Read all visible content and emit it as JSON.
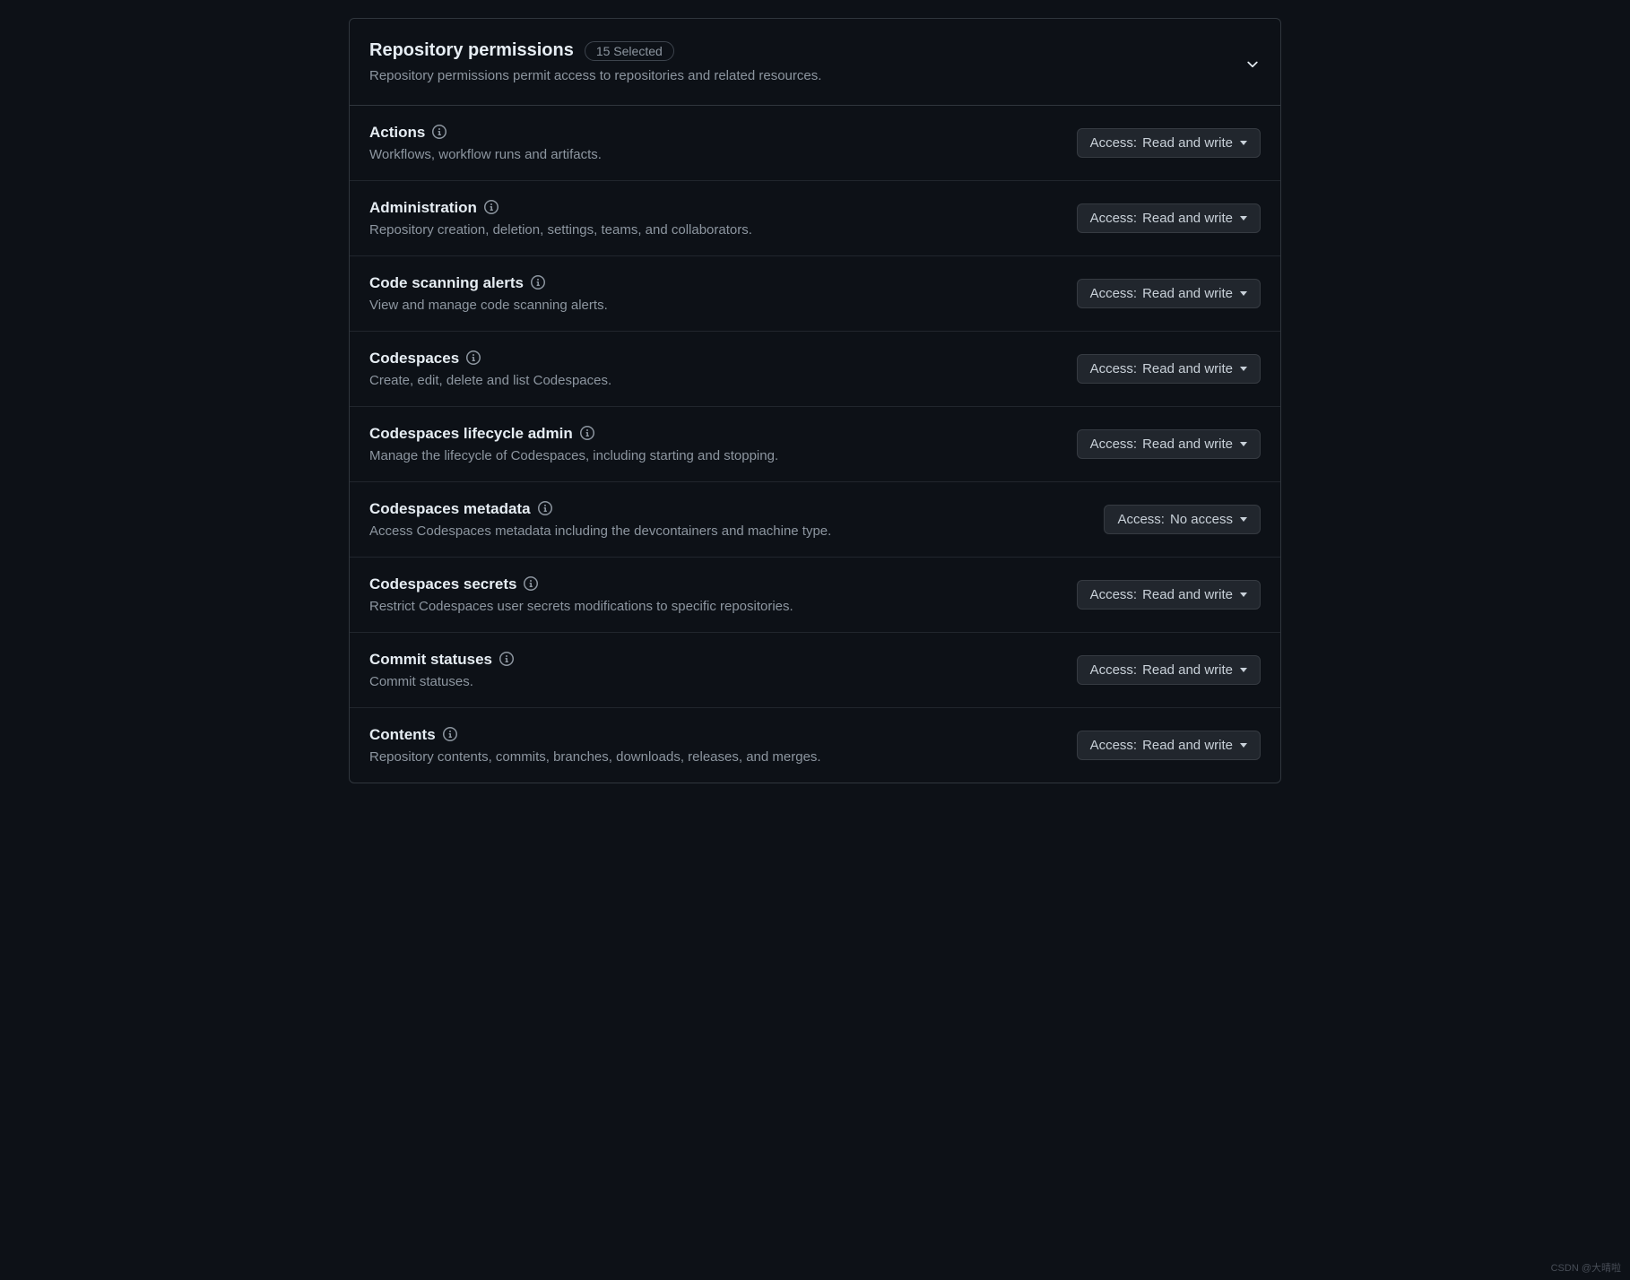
{
  "header": {
    "title": "Repository permissions",
    "selected_badge": "15 Selected",
    "subtitle": "Repository permissions permit access to repositories and related resources."
  },
  "access_prefix": "Access: ",
  "permissions": [
    {
      "title": "Actions",
      "desc": "Workflows, workflow runs and artifacts.",
      "access": "Read and write"
    },
    {
      "title": "Administration",
      "desc": "Repository creation, deletion, settings, teams, and collaborators.",
      "access": "Read and write"
    },
    {
      "title": "Code scanning alerts",
      "desc": "View and manage code scanning alerts.",
      "access": "Read and write"
    },
    {
      "title": "Codespaces",
      "desc": "Create, edit, delete and list Codespaces.",
      "access": "Read and write"
    },
    {
      "title": "Codespaces lifecycle admin",
      "desc": "Manage the lifecycle of Codespaces, including starting and stopping.",
      "access": "Read and write"
    },
    {
      "title": "Codespaces metadata",
      "desc": "Access Codespaces metadata including the devcontainers and machine type.",
      "access": "No access"
    },
    {
      "title": "Codespaces secrets",
      "desc": "Restrict Codespaces user secrets modifications to specific repositories.",
      "access": "Read and write"
    },
    {
      "title": "Commit statuses",
      "desc": "Commit statuses.",
      "access": "Read and write"
    },
    {
      "title": "Contents",
      "desc": "Repository contents, commits, branches, downloads, releases, and merges.",
      "access": "Read and write"
    }
  ],
  "watermark": "CSDN @大晴啦"
}
